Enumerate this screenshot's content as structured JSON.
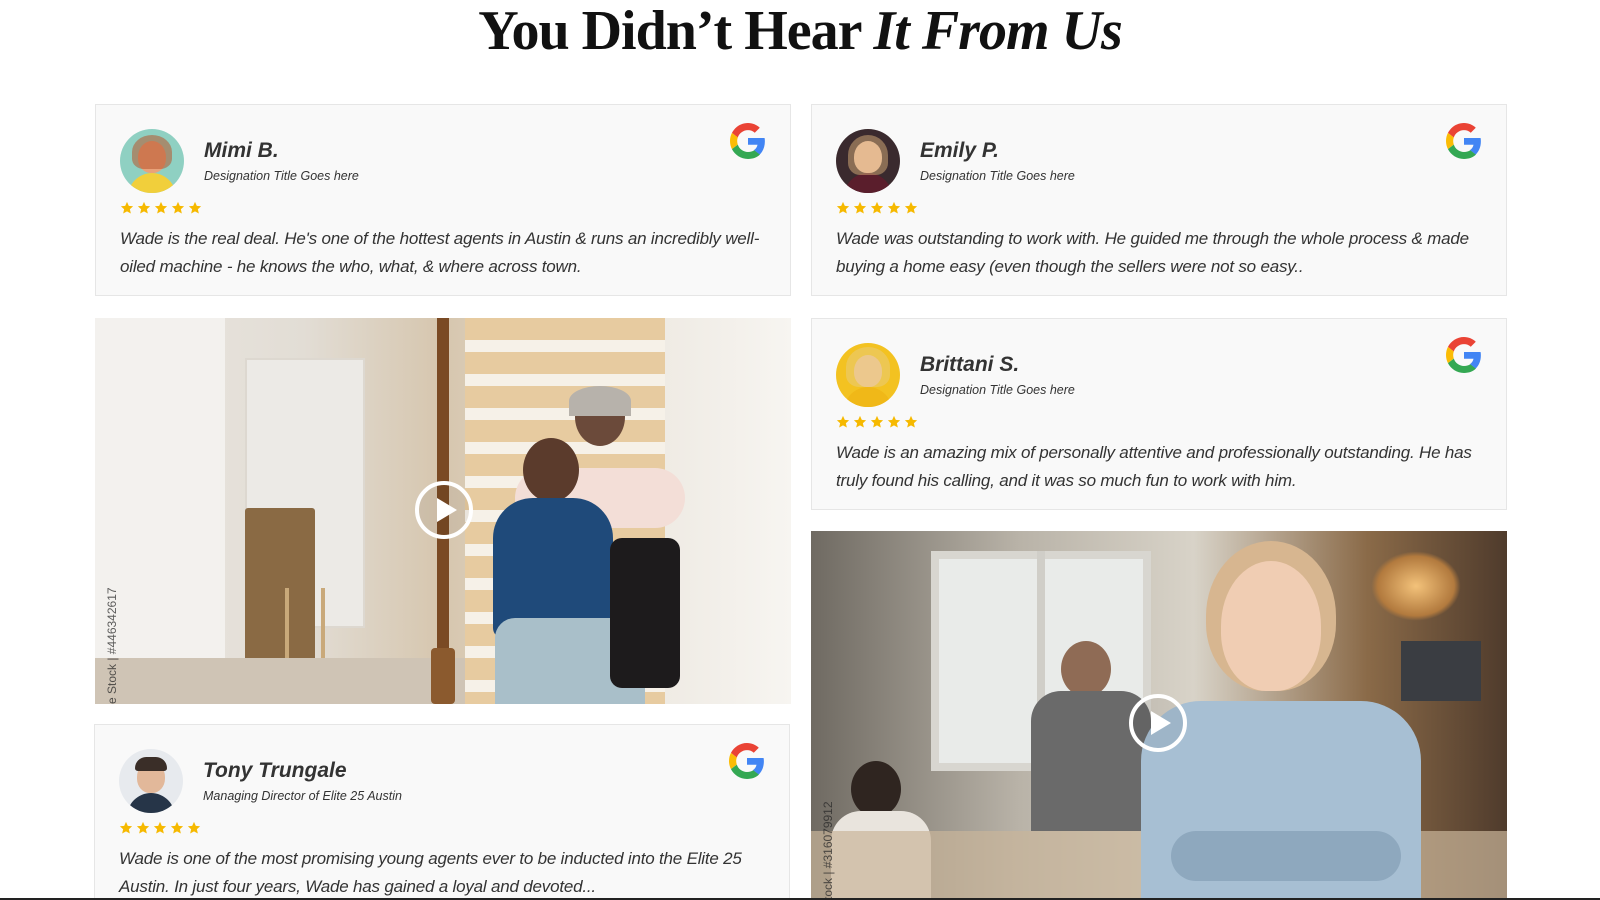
{
  "section": {
    "title_regular": "You Didn’t Hear ",
    "title_italic": "It From Us"
  },
  "reviews": [
    {
      "name": "Mimi B.",
      "role": "Designation Title Goes here",
      "rating": 5,
      "quote": "Wade is the real deal. He's one of the hottest agents in Austin & runs an incredibly well-oiled machine - he knows the who, what, & where across town.",
      "source_icon": "google-icon"
    },
    {
      "name": "Emily P.",
      "role": "Designation Title Goes here",
      "rating": 5,
      "quote": "Wade was outstanding to work with. He guided me through the whole process & made buying a home easy (even though the sellers were not so easy..",
      "source_icon": "google-icon"
    },
    {
      "name": "Brittani S.",
      "role": "Designation Title Goes here",
      "rating": 5,
      "quote": "Wade is an amazing mix of personally attentive and professionally outstanding. He has truly found his calling, and it was so much fun to work with him.",
      "source_icon": "google-icon"
    },
    {
      "name": "Tony Trungale",
      "role": "Managing Director of Elite 25 Austin",
      "rating": 5,
      "quote": "Wade is one of the most promising young agents ever to be inducted into the Elite 25 Austin. In just four years, Wade has gained a loyal and devoted...",
      "source_icon": "google-icon"
    }
  ],
  "videos": [
    {
      "watermark": "e Stock | #446342617",
      "icon": "play-icon"
    },
    {
      "watermark": "tock | #316079912",
      "icon": "play-icon"
    }
  ],
  "colors": {
    "star": "#f6b900",
    "card_bg": "#f9f9f9",
    "card_border": "#e6e6e6",
    "google_blue": "#4285F4",
    "google_red": "#EA4335",
    "google_yellow": "#FBBC05",
    "google_green": "#34A853"
  }
}
